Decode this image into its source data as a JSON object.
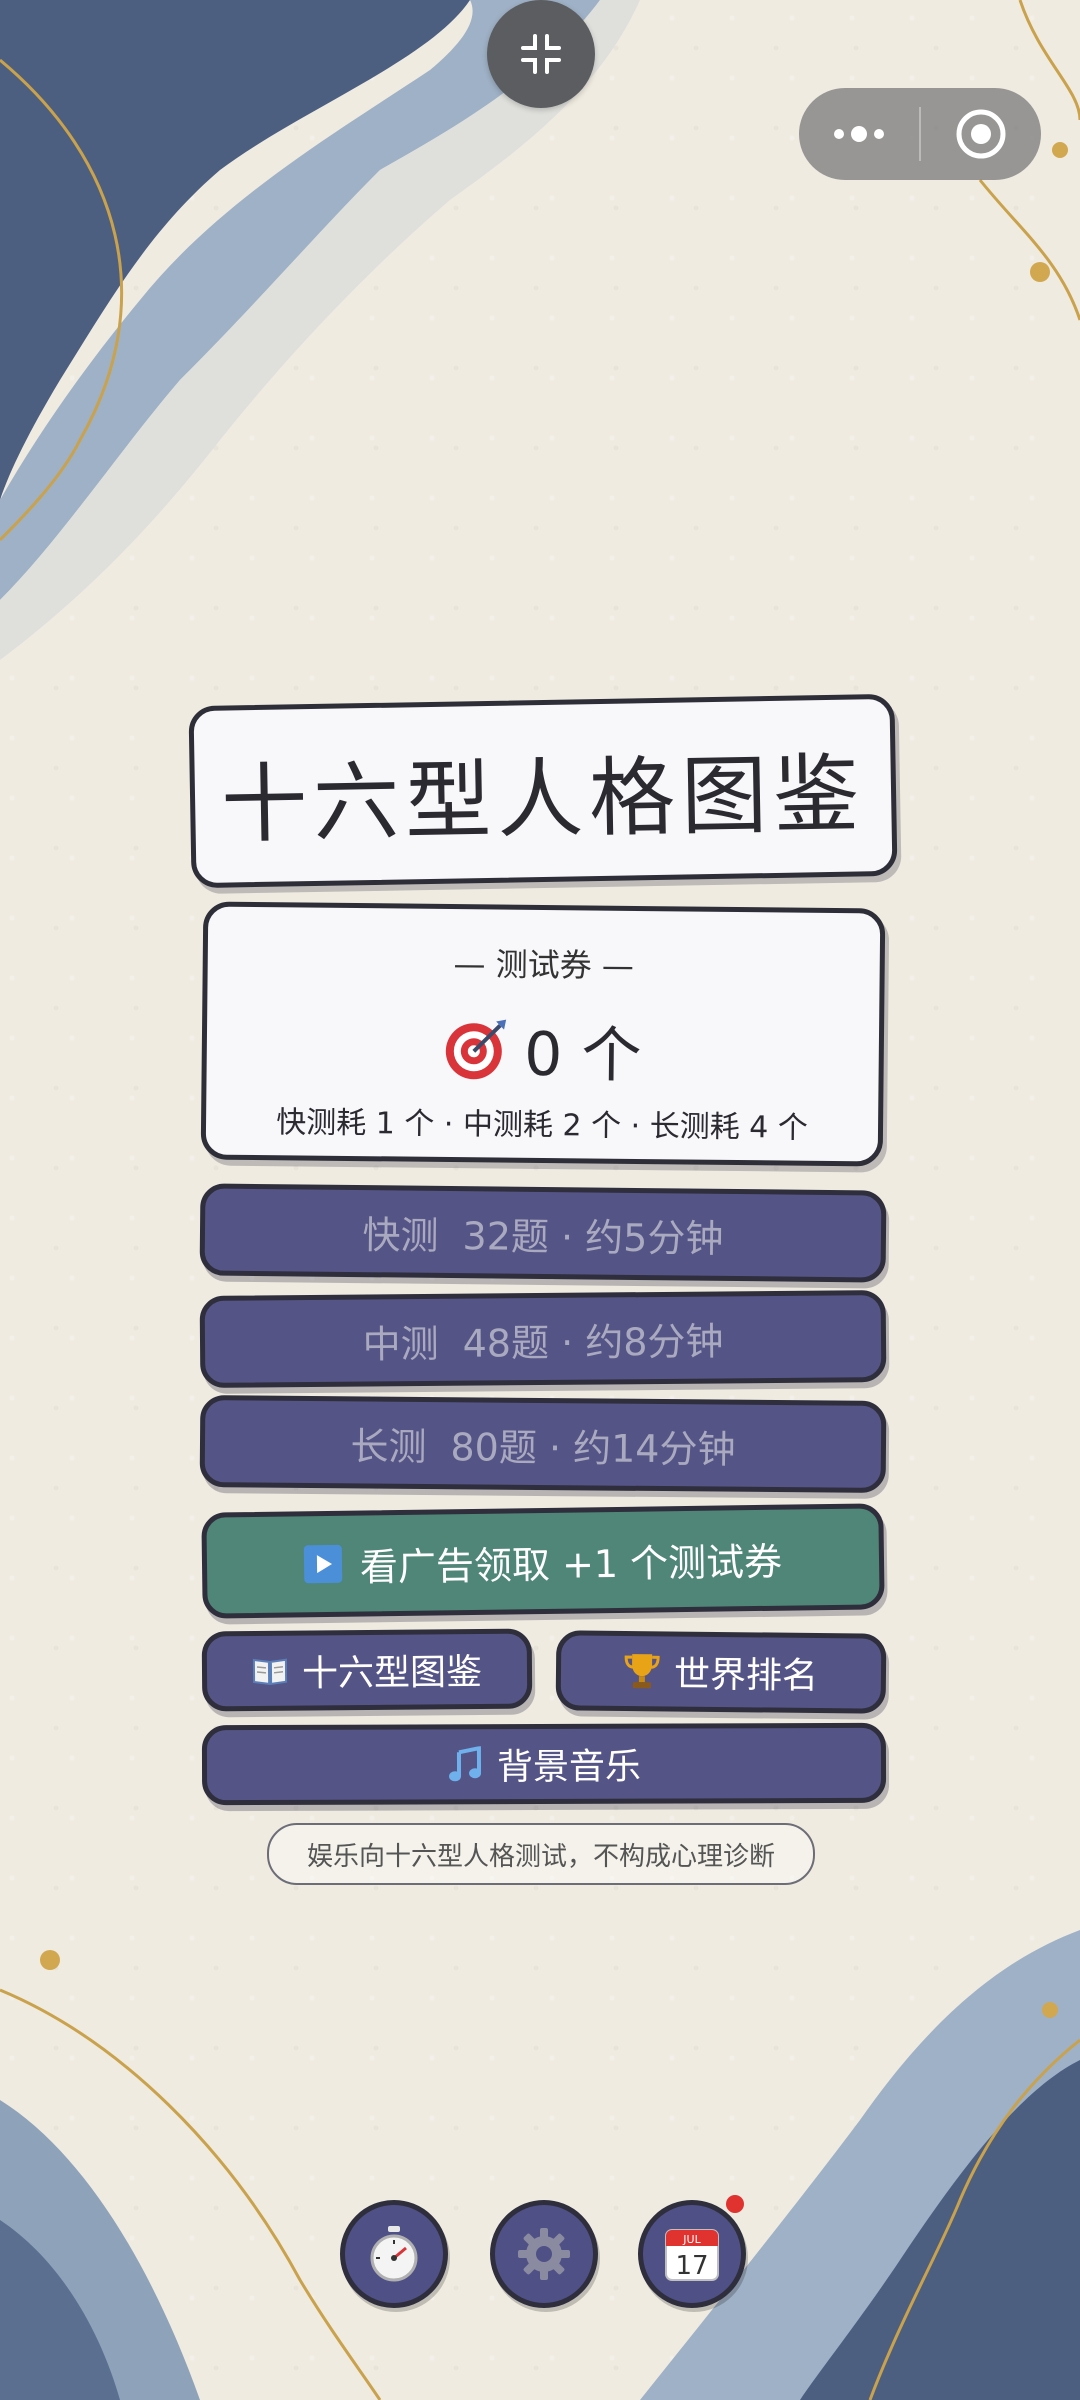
{
  "title": "十六型人格图鉴",
  "voucher": {
    "header": "— 测试券 —",
    "count": "0 个",
    "rule": "快测耗 1 个 · 中测耗 2 个 · 长测耗 4 个"
  },
  "modes": [
    {
      "name": "快测",
      "detail": "32题 · 约5分钟"
    },
    {
      "name": "中测",
      "detail": "48题 · 约8分钟"
    },
    {
      "name": "长测",
      "detail": "80题 · 约14分钟"
    }
  ],
  "ad_button": "看广告领取 +1 个测试券",
  "gallery_button": "十六型图鉴",
  "ranking_button": "世界排名",
  "music_button": "背景音乐",
  "disclaimer": "娱乐向十六型人格测试，不构成心理诊断",
  "calendar": {
    "month": "JUL",
    "day": "17"
  },
  "icons": {
    "collapse": "collapse-icon",
    "more": "more-dots-icon",
    "close": "target-close-icon",
    "voucher": "dart-target-icon",
    "play": "play-icon",
    "book": "book-icon",
    "trophy": "trophy-icon",
    "music": "music-note-icon",
    "timer": "stopwatch-icon",
    "settings": "gear-icon",
    "calendar": "calendar-icon"
  },
  "colors": {
    "mode_button": "#555486",
    "ad_button": "#4f8677",
    "outline": "#2f2e3c",
    "background": "#efebe1",
    "notification": "#e0322f"
  }
}
